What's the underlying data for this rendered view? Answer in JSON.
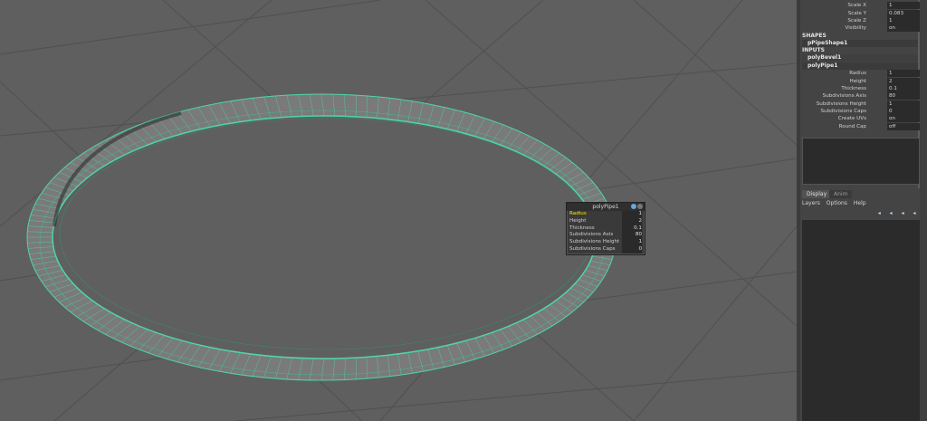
{
  "viewport": {
    "hud": {
      "title": "polyPipe1",
      "rows": [
        {
          "label": "Radius",
          "value": "1"
        },
        {
          "label": "Height",
          "value": "2"
        },
        {
          "label": "Thickness",
          "value": "0.1"
        },
        {
          "label": "Subdivisions Axis",
          "value": "80"
        },
        {
          "label": "Subdivisions Height",
          "value": "1"
        },
        {
          "label": "Subdivisions Caps",
          "value": "0"
        }
      ]
    }
  },
  "channel_box": {
    "transform_attrs": [
      {
        "label": "Scale X",
        "value": "1"
      },
      {
        "label": "Scale Y",
        "value": "0.083"
      },
      {
        "label": "Scale Z",
        "value": "1"
      },
      {
        "label": "Visibility",
        "value": "on"
      }
    ],
    "shapes_header": "SHAPES",
    "shape_node": "pPipeShape1",
    "inputs_header": "INPUTS",
    "input_nodes": [
      "polyBevel1",
      "polyPipe1"
    ],
    "pipe_attrs": [
      {
        "label": "Radius",
        "value": "1"
      },
      {
        "label": "Height",
        "value": "2"
      },
      {
        "label": "Thickness",
        "value": "0.1"
      },
      {
        "label": "Subdivisions Axis",
        "value": "80"
      },
      {
        "label": "Subdivisions Height",
        "value": "1"
      },
      {
        "label": "Subdivisions Caps",
        "value": "0"
      },
      {
        "label": "Create UVs",
        "value": "on"
      },
      {
        "label": "Round Cap",
        "value": "off"
      }
    ]
  },
  "layer_editor": {
    "tabs": [
      "Display",
      "Anim"
    ],
    "menus": [
      "Layers",
      "Options",
      "Help"
    ]
  },
  "colors": {
    "wire": "#4fd6a4",
    "hud_highlight": "#ffe600"
  }
}
